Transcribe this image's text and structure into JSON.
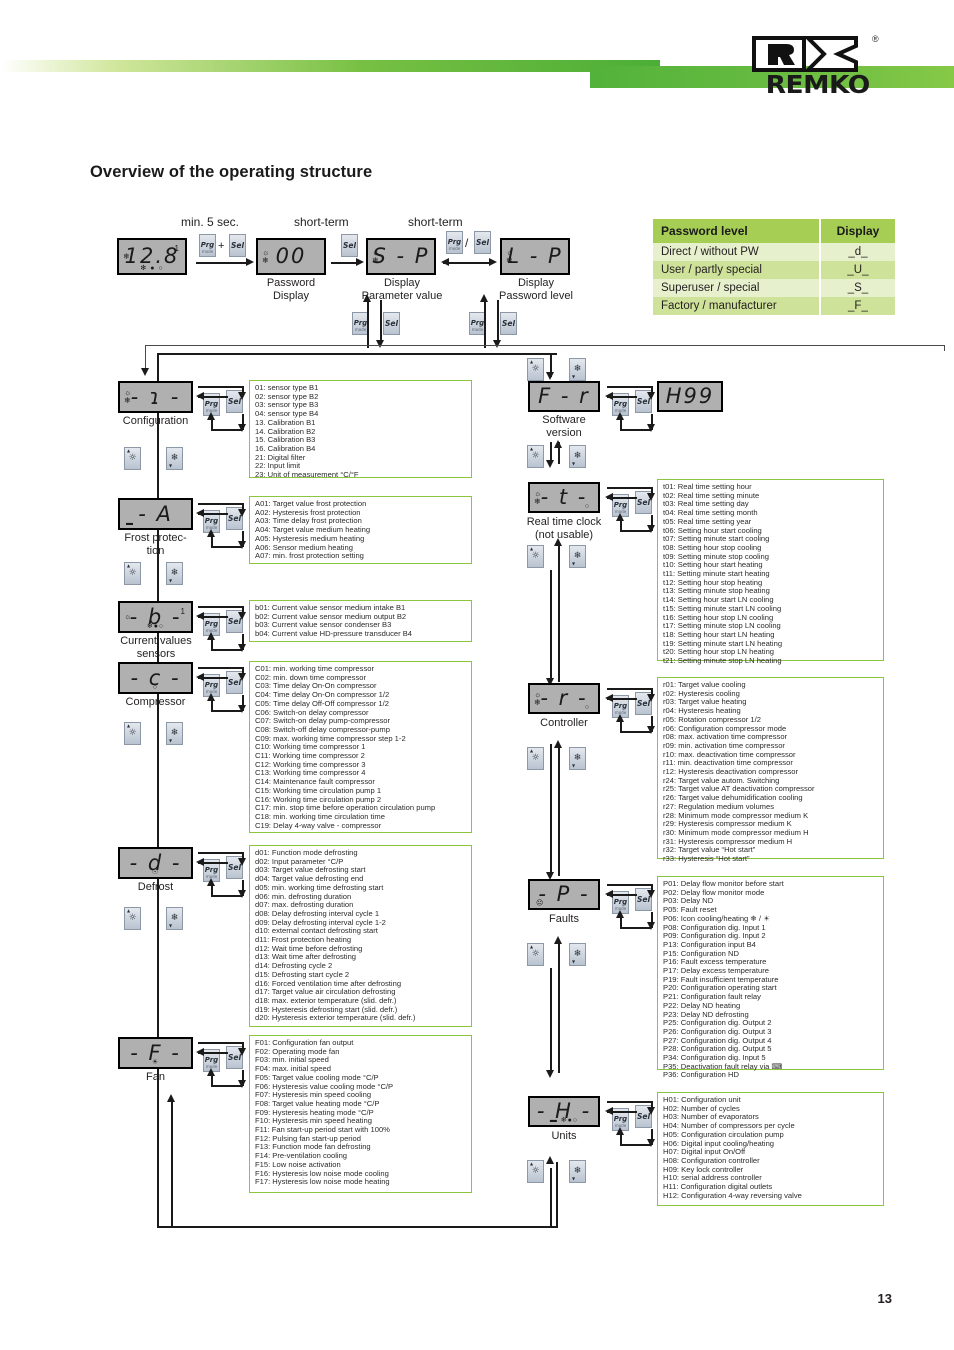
{
  "brand": {
    "name": "REMKO",
    "registered": "®"
  },
  "page_title": "Overview of the operating structure",
  "page_number": "13",
  "top_flow": {
    "labels": {
      "min5sec": "min. 5 sec.",
      "short_term_1": "short-term",
      "short_term_2": "short-term",
      "separator": "/"
    },
    "displays": [
      {
        "value": "12.8",
        "sup": "1",
        "caption": "",
        "icons_left": "❄",
        "icons_bottom": "✻ ● ○"
      },
      {
        "value": "00",
        "sup": "",
        "caption": "Password\nDisplay",
        "icons_left": "☀❄",
        "icons_bottom": ""
      },
      {
        "value": "S - P",
        "sup": "",
        "caption": "Display\nParameter value",
        "icons_left": "☀❄",
        "icons_bottom": ""
      },
      {
        "value": "L - P",
        "sup": "",
        "caption": "Display\nPassword level",
        "icons_left": "☀❄",
        "icons_bottom": ""
      }
    ],
    "keys": {
      "prg": "Prg",
      "prg_sub": "mode",
      "sel": "Sel",
      "plus": "+"
    }
  },
  "password_table": {
    "headers": {
      "level": "Password level",
      "display": "Display"
    },
    "rows": [
      {
        "level": "Direct / without PW",
        "display": "_d_"
      },
      {
        "level": "User / partly special",
        "display": "_U_"
      },
      {
        "level": "Superuser / special",
        "display": "_S_"
      },
      {
        "level": "Factory / manufacturer",
        "display": "_F_"
      }
    ]
  },
  "menus": [
    {
      "id": "configuration",
      "display": "- ɿ -",
      "caption": "Configuration",
      "params": [
        "01: sensor type B1",
        "02: sensor type B2",
        "03: sensor type B3",
        "04: sensor type B4",
        "13. Calibration B1",
        "14. Calibration B2",
        "15. Calibration B3",
        "16. Calibration B4",
        "21: Digital filter",
        "22: Input limit",
        "23: Unit of measurement °C/°F"
      ]
    },
    {
      "id": "frost-protection",
      "display": "- A",
      "caption": "Frost protec-\ntion",
      "params": [
        "A01: Target value frost protection",
        "A02: Hysteresis frost protection",
        "A03: Time delay frost protection",
        "A04: Target value medium heating",
        "A05: Hysteresis medium heating",
        "A06: Sensor medium heating",
        "A07: min. frost protection setting"
      ]
    },
    {
      "id": "current-values-sensors",
      "display": "- b -",
      "caption": "Current values\nsensors",
      "params": [
        "b01: Current value sensor medium intake B1",
        "b02: Current value sensor medium output B2",
        "b03: Current value sensor condenser B3",
        "b04: Current value HD-pressure transducer B4"
      ]
    },
    {
      "id": "compressor",
      "display": "- c -",
      "caption": "Compressor",
      "params": [
        "C01: min. working time compressor",
        "C02: min. down time compressor",
        "C03: Time delay On-On compressor",
        "C04: Time delay On-On compressor 1/2",
        "C05: Time delay Off-Off compressor 1/2",
        "C06: Switch-on delay compressor",
        "C07: Switch-on delay pump-compressor",
        "C08: Switch-off delay compressor-pump",
        "C09: max. working time compressor step 1-2",
        "C10: Working time compressor 1",
        "C11: Working time compressor 2",
        "C12: Working time compressor 3",
        "C13: Working time compressor 4",
        "C14: Maintenance fault compressor",
        "C15: Working time circulation pump 1",
        "C16: Working time circulation pump 2",
        "C17: min. stop time before operation circulation pump",
        "C18: min. working time circulation time",
        "C19: Delay 4-way valve - compressor"
      ]
    },
    {
      "id": "defrost",
      "display": "- d -",
      "caption": "Defrost",
      "params": [
        "d01: Function mode defrosting",
        "d02: Input parameter °C/P",
        "d03: Target value defrosting start",
        "d04: Target value defrosting end",
        "d05: min. working time defrosting start",
        "d06: min. defrosting duration",
        "d07: max. defrosting duration",
        "d08: Delay defrosting interval cycle 1",
        "d09: Delay defrosting interval cycle 1-2",
        "d10: external contact defrosting start",
        "d11: Frost protection heating",
        "d12: Wait time before defrosting",
        "d13: Wait time after defrosting",
        "d14: Defrosting cycle 2",
        "d15: Defrosting start cycle 2",
        "d16: Forced ventilation time after defrosting",
        "d17: Target value air circulation defrosting",
        "d18: max. exterior temperature (slid. defr.)",
        "d19: Hysteresis defrosting start (slid. defr.)",
        "d20: Hysteresis exterior temperature (slid. defr.)"
      ]
    },
    {
      "id": "fan",
      "display": "- F -",
      "caption": "Fan",
      "params": [
        "F01: Configuration fan output",
        "F02: Operating mode fan",
        "F03: min. initial speed",
        "F04: max. initial speed",
        "F05: Target value cooling mode °C/P",
        "F06: Hysteresis value cooling mode °C/P",
        "F07: Hysteresis min speed cooling",
        "F08: Target value heating mode °C/P",
        "F09: Hysteresis heating mode °C/P",
        "F10: Hysteresis min speed heating",
        "F11: Fan start-up period start with 100%",
        "F12: Pulsing fan start-up period",
        "F13: Function mode fan defrosting",
        "F14: Pre-ventilation cooling",
        "F15: Low noise activation",
        "F16: Hysteresis low noise mode cooling",
        "F17: Hysteresis low noise mode heating"
      ]
    },
    {
      "id": "software-version",
      "display": "F - r",
      "caption": "Software\nversion",
      "value_display": "H99",
      "params": []
    },
    {
      "id": "real-time-clock",
      "display": "- t -",
      "caption": "Real time clock\n(not usable)",
      "params": [
        "t01: Real time setting hour",
        "t02: Real time setting minute",
        "t03: Real time setting day",
        "t04: Real time setting month",
        "t05: Real time setting year",
        "t06: Setting hour start cooling",
        "t07: Setting minute start cooling",
        "t08: Setting hour stop cooling",
        "t09: Setting minute stop cooling",
        "t10: Setting hour start heating",
        "t11: Setting minute start heating",
        "t12: Setting hour stop heating",
        "t13: Setting minute stop heating",
        "t14: Setting hour start LN cooling",
        "t15: Setting minute start LN cooling",
        "t16: Setting hour stop LN cooling",
        "t17: Setting minute stop LN cooling",
        "t18: Setting hour start LN heating",
        "t19: Setting minute start LN heating",
        "t20: Setting hour stop LN heating",
        "t21: Setting minute stop LN heating"
      ]
    },
    {
      "id": "controller",
      "display": "- r -",
      "caption": "Controller",
      "params": [
        "r01: Target value cooling",
        "r02: Hysteresis cooling",
        "r03: Target value heating",
        "r04: Hysteresis heating",
        "r05: Rotation compressor 1/2",
        "r06: Configuration compressor mode",
        "r08: max. activation time compressor",
        "r09: min. activation time compressor",
        "r10: max. deactivation time compressor",
        "r11: min. deactivation time compressor",
        "r12: Hysteresis deactivation compressor",
        "r24: Target value autom. Switching",
        "r25: Target value AT deactivation compressor",
        "r26: Target value dehumidification cooling",
        "r27: Regulation medium volumes",
        "r28: Minimum mode compressor medium K",
        "r29: Hysteresis compressor medium K",
        "r30: Minimum mode compressor medium H",
        "r31: Hysteresis compressor medium H",
        "r32: Target value “Hot start”",
        "r33: Hysteresis “Hot start”"
      ]
    },
    {
      "id": "faults",
      "display": "- P -",
      "caption": "Faults",
      "params": [
        "P01: Delay flow monitor before start",
        "P02: Delay flow monitor mode",
        "P03: Delay ND",
        "P05: Fault reset",
        "P06: Icon cooling/heating ❄ / ☀",
        "P08: Configuration dig. Input 1",
        "P09: Configuration dig. Input 2",
        "P13: Configuration input B4",
        "P15: Configuration ND",
        "P16: Fault excess temperature",
        "P17: Delay excess temperature",
        "P19: Fault insufficient temperature",
        "P20: Configuration operating start",
        "P21: Configuration fault relay",
        "P22: Delay ND heating",
        "P23: Delay ND defrosting",
        "P25: Configuration dig. Output 2",
        "P26: Configuration dig. Output 3",
        "P27: Configuration dig. Output 4",
        "P28: Configuration dig. Output 5",
        "P34: Configuration dig. Input 5",
        "P35: Deactivation fault relay via ⌨",
        "P36: Configuration HD"
      ]
    },
    {
      "id": "units",
      "display": "- H -",
      "caption": "Units",
      "params": [
        "H01: Configuration unit",
        "H02: Number of cycles",
        "H03: Number of evaporators",
        "H04: Number of compressors per cycle",
        "H05: Configuration circulation pump",
        "H06: Digital input cooling/heating",
        "H07: Digital input On/Off",
        "H08: Configuration controller",
        "H09: Key lock controller",
        "H10: serial address controller",
        "H11: Configuration digital outlets",
        "H12: Configuration 4-way reversing valve"
      ]
    }
  ],
  "colors": {
    "brand_green": "#8cc63f",
    "table_header": "#a6ce55",
    "table_row_odd": "#e6f0cd",
    "table_row_even": "#cfe29a",
    "lcd_bg": "#b0b0b0"
  }
}
